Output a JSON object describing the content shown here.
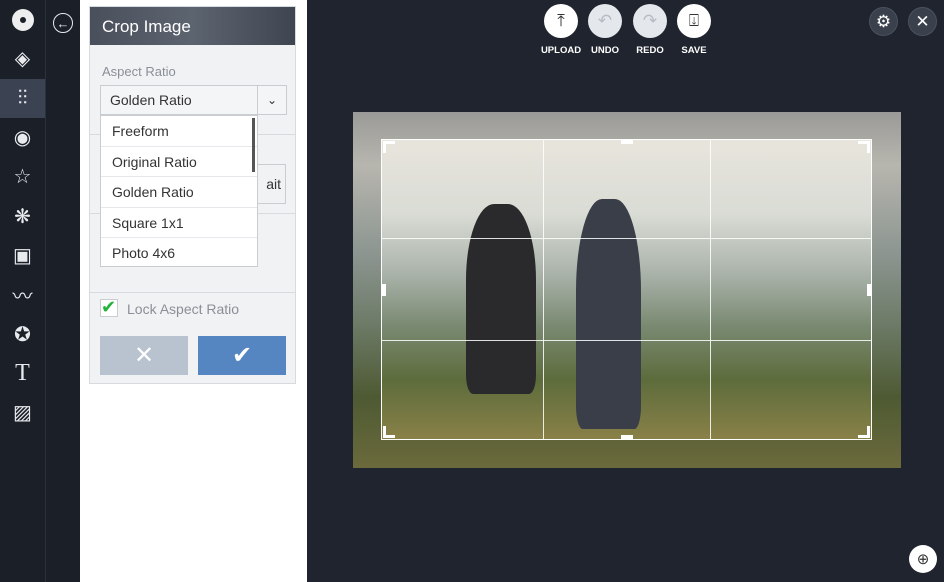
{
  "sidebar": {
    "items": [
      "logo",
      "layers",
      "adjust",
      "eye",
      "star",
      "flower",
      "frame",
      "mustache",
      "badge",
      "text",
      "texture"
    ]
  },
  "panel": {
    "title": "Crop Image",
    "aspect_label": "Aspect Ratio",
    "selected": "Golden Ratio",
    "options": [
      "Freeform",
      "Original Ratio",
      "Golden Ratio",
      "Square 1x1",
      "Photo 4x6"
    ],
    "partial_button": "ait",
    "lock_label": "Lock Aspect Ratio",
    "lock_checked": true
  },
  "toolbar": {
    "upload": "UPLOAD",
    "undo": "UNDO",
    "redo": "REDO",
    "save": "SAVE"
  },
  "colors": {
    "accent": "#5586c2",
    "cancel": "#b9c2cf",
    "bg": "#1f242e"
  }
}
